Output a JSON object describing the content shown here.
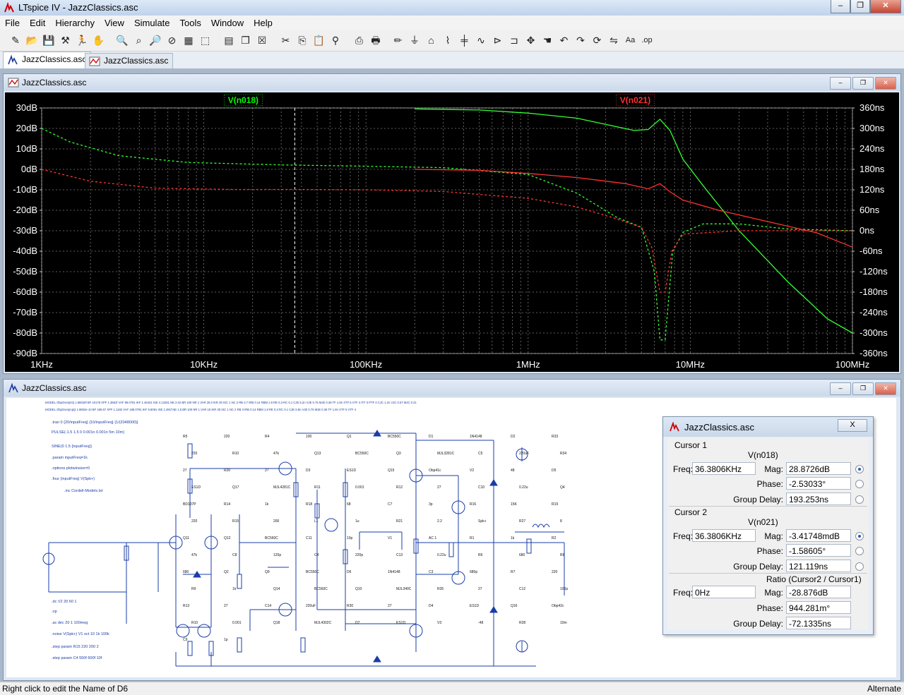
{
  "app": {
    "title": "LTspice IV - JazzClassics.asc"
  },
  "menu": [
    "File",
    "Edit",
    "Hierarchy",
    "View",
    "Simulate",
    "Tools",
    "Window",
    "Help"
  ],
  "toolbar_icons": [
    "new-schematic-icon",
    "open-icon",
    "save-icon",
    "control-panel-icon",
    "run-icon",
    "halt-icon",
    "zoom-in-icon",
    "zoom-area-icon",
    "zoom-out-icon",
    "zoom-cancel-icon",
    "autorange-icon",
    "zoom-fit-icon",
    "tile-horizontal-icon",
    "cascade-icon",
    "close-all-icon",
    "cut-icon",
    "copy-icon",
    "paste-icon",
    "find-icon",
    "print-setup-icon",
    "print-icon",
    "wire-icon",
    "ground-icon",
    "label-icon",
    "resistor-icon",
    "capacitor-icon",
    "inductor-icon",
    "diode-icon",
    "component-icon",
    "move-icon",
    "drag-icon",
    "undo-icon",
    "redo-icon",
    "rotate-icon",
    "mirror-icon",
    "text-icon",
    "spice-directive-icon"
  ],
  "tabs": [
    "JazzClassics.asc",
    "JazzClassics.asc"
  ],
  "plot_window": {
    "title": "JazzClassics.asc",
    "trace_labels": [
      {
        "name": "V(n018)",
        "color": "#00ff00"
      },
      {
        "name": "V(n021)",
        "color": "#ff3030"
      }
    ]
  },
  "chart_data": {
    "type": "line",
    "xscale": "log",
    "xlim": [
      1000,
      100000000
    ],
    "x_ticks": [
      "1KHz",
      "10KHz",
      "100KHz",
      "1MHz",
      "10MHz",
      "100MHz"
    ],
    "y_left_ticks": [
      "30dB",
      "20dB",
      "10dB",
      "0dB",
      "-10dB",
      "-20dB",
      "-30dB",
      "-40dB",
      "-50dB",
      "-60dB",
      "-70dB",
      "-80dB",
      "-90dB"
    ],
    "y_left_lim": [
      -90,
      30
    ],
    "y_right_ticks": [
      "360ns",
      "300ns",
      "240ns",
      "180ns",
      "120ns",
      "60ns",
      "0ns",
      "-60ns",
      "-120ns",
      "-180ns",
      "-240ns",
      "-300ns",
      "-360ns"
    ],
    "y_right_lim": [
      -360,
      360
    ],
    "grid": true,
    "cursor_x": 36380.6,
    "series": [
      {
        "name": "V(n018)",
        "style": "solid",
        "color": "#33ff33",
        "x": [
          200000,
          500000,
          1000000,
          2000000,
          3000000,
          4500000,
          5500000,
          6500000,
          7500000,
          9000000,
          12000000,
          20000000,
          40000000,
          70000000,
          100000000
        ],
        "y": [
          29.5,
          29,
          27.5,
          25,
          22,
          19,
          19.5,
          24.5,
          19,
          5,
          -8,
          -30,
          -55,
          -73,
          -80
        ]
      },
      {
        "name": "V(n018) group delay",
        "style": "dashed",
        "color": "#33ff33",
        "axis": "right",
        "x": [
          1000,
          1500,
          3000,
          8000,
          30000,
          100000,
          300000,
          1000000,
          2000000,
          3500000,
          5000000,
          6000000,
          6500000,
          7000000,
          7800000,
          9000000,
          12000000,
          20000000,
          40000000,
          100000000
        ],
        "y": [
          300,
          260,
          220,
          200,
          193,
          189,
          185,
          165,
          110,
          40,
          10,
          -120,
          -320,
          -320,
          -60,
          -5,
          20,
          20,
          5,
          0
        ]
      },
      {
        "name": "V(n021)",
        "style": "solid",
        "color": "#ff3333",
        "x": [
          200000,
          500000,
          1000000,
          2000000,
          4000000,
          5500000,
          6500000,
          7500000,
          9000000,
          15000000,
          30000000,
          60000000,
          100000000
        ],
        "y": [
          0,
          -0.5,
          -2,
          -4,
          -7,
          -9.5,
          -7,
          -11,
          -15,
          -20,
          -25.5,
          -31,
          -38
        ]
      },
      {
        "name": "V(n021) group delay",
        "style": "dashed",
        "color": "#ff3333",
        "axis": "right",
        "x": [
          1000,
          2000,
          5000,
          15000,
          36000,
          100000,
          300000,
          1000000,
          2000000,
          3500000,
          5000000,
          5800000,
          6500000,
          7000000,
          7700000,
          9000000,
          20000000,
          100000000
        ],
        "y": [
          180,
          145,
          125,
          121,
          121,
          120,
          115,
          95,
          70,
          35,
          10,
          -50,
          -180,
          -180,
          -60,
          -10,
          0,
          0
        ]
      }
    ]
  },
  "schematic_window": {
    "title": "JazzClassics.asc"
  },
  "schematic": {
    "directives": [
      ".tran 0 {20/inputFreq} {10/inputFreq} {1/(2048000)}",
      "PULSE(-1.5 1.5 0 0.001n 0.001n 5m 10m)",
      "SINE(0 1.5 {inputFreq})",
      ".param inputFreq=1k",
      ".options plotwinsize=0",
      ".four {inputFreq} V(Spk+)",
      ".inc Cordell-Models.txt",
      ".dc V2 20 60 1",
      ".op",
      ".ac dec 20 1 100meg",
      ".noise V(Spk+) V1 oct 10 1k 100k",
      ".step param R15 220 200 2",
      ".step param C4 550f 600f 10f"
    ],
    "labels": [
      "R5",
      "220",
      "R4",
      "100",
      "Q1",
      "BC550C",
      "D1",
      "1N4148",
      "D2",
      "R33",
      "220",
      "R10",
      "47k",
      "Q13",
      "BC550C",
      "Q3",
      "MJL3281C",
      "C5",
      "220uF",
      "R34",
      "27",
      "R20",
      "27",
      "D3",
      "ES1D",
      "Q15",
      "Obp41c",
      "V2",
      "48",
      "D5",
      "ES1D",
      "Q17",
      "MJL4281C",
      "R11",
      "0.001",
      "R12",
      "27",
      "C10",
      "0.22u",
      "Q4",
      "BD137P",
      "R14",
      "1k",
      "R18",
      "68",
      "C7",
      "3p",
      "R16",
      "15K",
      "R19",
      "220",
      "R15",
      "200",
      "L1",
      "1u",
      "R21",
      "2.2",
      "Spk+",
      "R27",
      "8",
      "Q11",
      "Q12",
      "BC560C",
      "C11",
      "10p",
      "V1",
      "AC 1",
      "R1",
      "1k",
      "R2",
      "47k",
      "C8",
      "120p",
      "C4",
      "220p",
      "C13",
      "0.22u",
      "R6",
      "680",
      "R8",
      "680",
      "Q2",
      "Q9",
      "BC550C",
      "D6",
      "1N4148",
      "C3",
      "680p",
      "R7",
      "220",
      "R9",
      "1k",
      "Q14",
      "BC560C",
      "Q10",
      "MJL340C",
      "R35",
      "27",
      "C12",
      "100p",
      "R13",
      "27",
      "C14",
      "220uF",
      "R30",
      "27",
      "D4",
      "ES1D",
      "Q16",
      "Obp42c",
      "R10",
      "0.001",
      "Q18",
      "MJL4302C",
      "D7",
      "ES1D",
      "V3",
      "-48",
      "R28",
      "10m",
      "C9",
      "1p"
    ],
    "header_lines": [
      ".MODEL ObpOverptrQ 1.88026f BF 10178 XPF 1.3681f VAF 89.0781 IKF 1.46431 ISE 4.12281 NE 2.02 BR 100 NR 1 VAR 25.0 IKR 30 ISC 1 NC 2 RB 3.7 IRB 0.14 RBM 1.9 RE 0.3 RC 0.1 CJE 5.2n VJE 0.75 MJE 0.36 TF 1.8n XTF 5 VTF 4 ITF 3 PTF 0 CJC 1.2n VJC 0.57 MJC 0.41",
      ".MODEL ObpOverpnpQ 1.8802e-10 BF 186.67 XPF 1.1182 VAF 186.0781 IKF 5.8091 ISE 1.291f NE 1.5 BR 100 NR 1 VAR 18 IKR 30 ISC 1 NC 2 RB 3 IRB 0.14 RBM 1.9 RE 0.3 RC 0.1 CJE 5.8n VJE 0.75 MJE 0.36 TF 1.8n XTF 5 VTF 4"
    ]
  },
  "cursor_dialog": {
    "title": "JazzClassics.asc",
    "close_label": "X",
    "cursor1": {
      "label": "Cursor 1",
      "trace": "V(n018)",
      "freq_label": "Freq:",
      "freq": "36.3806KHz",
      "mag_label": "Mag:",
      "mag": "28.8726dB",
      "phase_label": "Phase:",
      "phase": "-2.53033°",
      "delay_label": "Group Delay:",
      "delay": "193.253ns"
    },
    "cursor2": {
      "label": "Cursor 2",
      "trace": "V(n021)",
      "freq_label": "Freq:",
      "freq": "36.3806KHz",
      "mag_label": "Mag:",
      "mag": "-3.41748mdB",
      "phase_label": "Phase:",
      "phase": "-1.58605°",
      "delay_label": "Group Delay:",
      "delay": "121.119ns"
    },
    "ratio": {
      "label": "Ratio (Cursor2 / Cursor1)",
      "freq_label": "Freq:",
      "freq": "0Hz",
      "mag_label": "Mag:",
      "mag": "-28.876dB",
      "phase_label": "Phase:",
      "phase": "944.281m°",
      "delay_label": "Group Delay:",
      "delay": "-72.1335ns"
    }
  },
  "status": {
    "left": "Right click to edit the Name of D6",
    "right": "Alternate"
  }
}
